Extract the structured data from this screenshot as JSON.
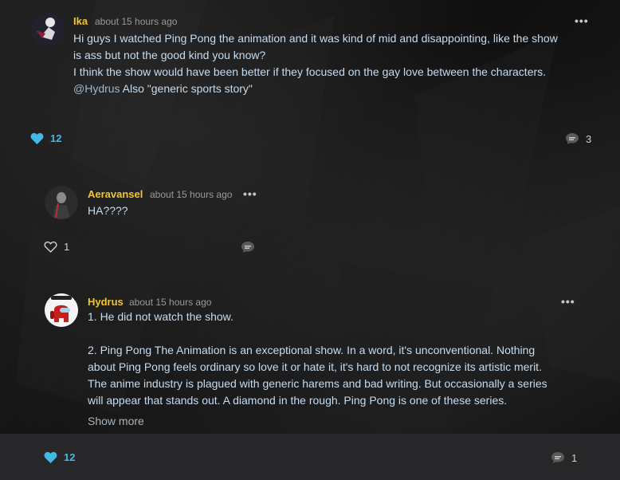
{
  "comments": [
    {
      "author": "Ika",
      "time": "about 15 hours ago",
      "lines": [
        "Hi guys I watched Ping Pong the animation and it was kind of mid and disappointing, like the show is ass but not the good kind you know?",
        "I think the show would have been better if they focused on the gay love between the characters."
      ],
      "mention": "@Hydrus",
      "mention_text": " Also \"generic sports story\"",
      "likes": "12",
      "replies": "3"
    },
    {
      "author": "Aeravansel",
      "time": "about 15 hours ago",
      "text": "HA????",
      "likes": "1"
    },
    {
      "author": "Hydrus",
      "time": "about 15 hours ago",
      "paragraphs": [
        "1. He did not watch the show.",
        "2. Ping Pong The Animation is an exceptional show. In a word, it's unconventional. Nothing about Ping Pong feels ordinary so love it or hate it, it's hard to not recognize its artistic merit. The anime industry is plagued with generic harems and bad writing. But occasionally a series will appear that stands out. A diamond in the rough. Ping Pong is one of these series."
      ],
      "show_more": "Show more",
      "likes": "12",
      "replies": "1"
    }
  ],
  "icons": {
    "more": "more-dots-icon",
    "like_active": "heart-filled-icon",
    "like_inactive": "heart-outline-icon",
    "reply": "speech-bubble-icon"
  },
  "colors": {
    "username": "#f2c531",
    "liked": "#3fb9e8",
    "body_text": "#c6dcf0"
  }
}
